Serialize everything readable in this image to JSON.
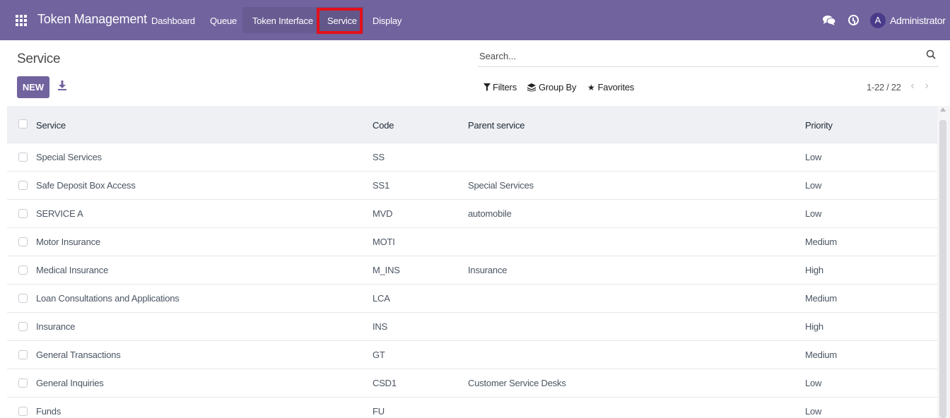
{
  "navbar": {
    "brand": "Token Management",
    "menu": [
      {
        "label": "Dashboard"
      },
      {
        "label": "Queue"
      },
      {
        "label": "Token Interface"
      },
      {
        "label": "Service"
      },
      {
        "label": "Display"
      }
    ],
    "avatar_initial": "A",
    "user_name": "Administrator",
    "bg_color": "#71639e",
    "highlight_color": "#e3101b"
  },
  "control_panel": {
    "title": "Service",
    "new_button": "NEW",
    "search_placeholder": "Search...",
    "filters_label": "Filters",
    "group_by_label": "Group By",
    "favorites_label": "Favorites",
    "pager_value": "1-22 / 22"
  },
  "table": {
    "columns": [
      "Service",
      "Code",
      "Parent service",
      "Priority"
    ],
    "rows": [
      {
        "service": "Special Services",
        "code": "SS",
        "parent": "",
        "priority": "Low"
      },
      {
        "service": "Safe Deposit Box Access",
        "code": "SS1",
        "parent": "Special Services",
        "priority": "Low"
      },
      {
        "service": "SERVICE A",
        "code": "MVD",
        "parent": "automobile",
        "priority": "Low"
      },
      {
        "service": "Motor Insurance",
        "code": "MOTI",
        "parent": "",
        "priority": "Medium"
      },
      {
        "service": "Medical Insurance",
        "code": "M_INS",
        "parent": "Insurance",
        "priority": "High"
      },
      {
        "service": "Loan Consultations and Applications",
        "code": "LCA",
        "parent": "",
        "priority": "Medium"
      },
      {
        "service": "Insurance",
        "code": "INS",
        "parent": "",
        "priority": "High"
      },
      {
        "service": "General Transactions",
        "code": "GT",
        "parent": "",
        "priority": "Medium"
      },
      {
        "service": "General Inquiries",
        "code": "CSD1",
        "parent": "Customer Service Desks",
        "priority": "Low"
      },
      {
        "service": "Funds",
        "code": "FU",
        "parent": "",
        "priority": "Low"
      }
    ]
  }
}
